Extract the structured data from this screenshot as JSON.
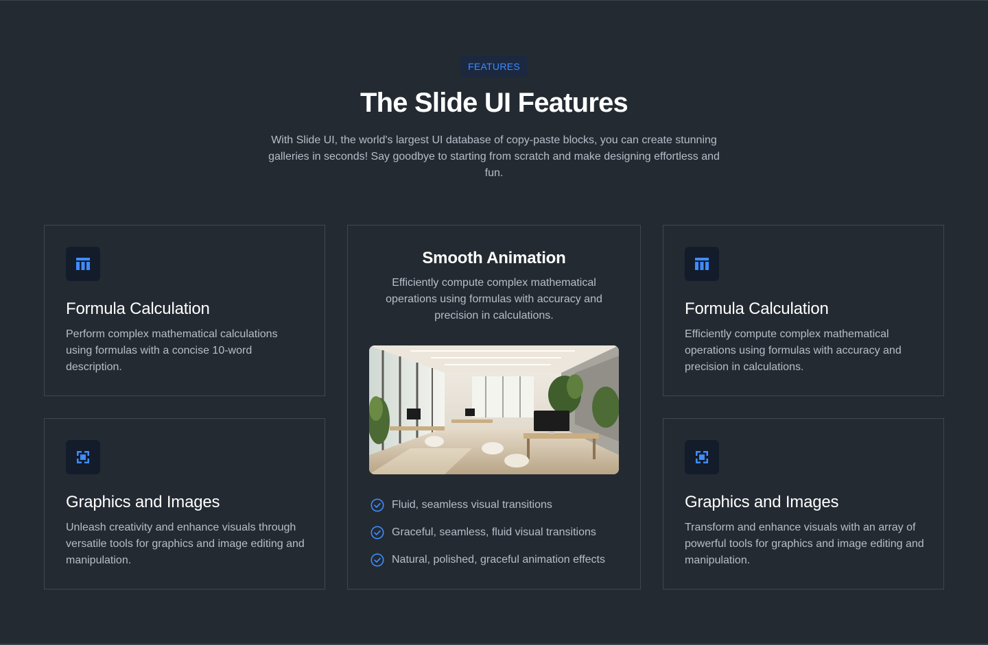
{
  "header": {
    "badge": "FEATURES",
    "title": "The Slide UI Features",
    "subtitle": "With Slide UI, the world's largest UI database of copy-paste blocks, you can create stunning galleries in seconds! Say goodbye to starting from scratch and make designing effortless and fun."
  },
  "cards": {
    "top_left": {
      "icon": "table-icon",
      "title": "Formula Calculation",
      "description": "Perform complex mathematical calculations using formulas with a concise 10-word description."
    },
    "bottom_left": {
      "icon": "frame-icon",
      "title": "Graphics and Images",
      "description": "Unleash creativity and enhance visuals through versatile tools for graphics and image editing and manipulation."
    },
    "top_right": {
      "icon": "table-icon",
      "title": "Formula Calculation",
      "description": "Efficiently compute complex mathematical operations using formulas with accuracy and precision in calculations."
    },
    "bottom_right": {
      "icon": "frame-icon",
      "title": "Graphics and Images",
      "description": "Transform and enhance visuals with an array of powerful tools for graphics and image editing and manipulation."
    },
    "middle": {
      "title": "Smooth Animation",
      "description": "Efficiently compute complex mathematical operations using formulas with accuracy and precision in calculations.",
      "image": "office-interior-photo",
      "features": [
        "Fluid, seamless visual transitions",
        "Graceful, seamless, fluid visual transitions",
        "Natural, polished, graceful animation effects"
      ]
    }
  },
  "colors": {
    "background": "#232a32",
    "accent": "#3f8cff",
    "border": "#3e4751",
    "muted_text": "#b7bec8"
  }
}
